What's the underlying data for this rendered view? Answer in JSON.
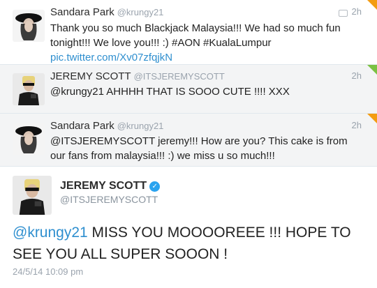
{
  "tweets": [
    {
      "name": "Sandara Park",
      "handle": "@krungy21",
      "time": "2h",
      "text": "Thank you so much Blackjack Malaysia!!! We had so much fun tonight!!! We love you!!! :) #AON #KualaLumpur ",
      "link": "pic.twitter.com/Xv07zfqjkN"
    },
    {
      "name": "JEREMY SCOTT",
      "handle": "@ITSJEREMYSCOTT",
      "time": "2h",
      "text": "@krungy21 AHHHH THAT IS SOOO CUTE !!!! XXX"
    },
    {
      "name": "Sandara Park",
      "handle": "@krungy21",
      "time": "2h",
      "text": "@ITSJEREMYSCOTT jeremy!!! How are you? This cake is from our fans from malaysia!!! :) we miss u so much!!!"
    }
  ],
  "detail": {
    "name": "JEREMY SCOTT",
    "verified_glyph": "✓",
    "handle": "@ITSJEREMYSCOTT",
    "mention": "@krungy21",
    "text": " MISS YOU MOOOOREEE !!! HOPE TO SEE YOU ALL SUPER SOOON !",
    "timestamp": "24/5/14 10:09 pm"
  },
  "colors": {
    "link": "#2f8fcf",
    "verified": "#2aa3ef",
    "corner_orange": "#f39c12",
    "corner_green": "#7bc143"
  },
  "icons": [
    "media-icon",
    "verified-icon"
  ]
}
